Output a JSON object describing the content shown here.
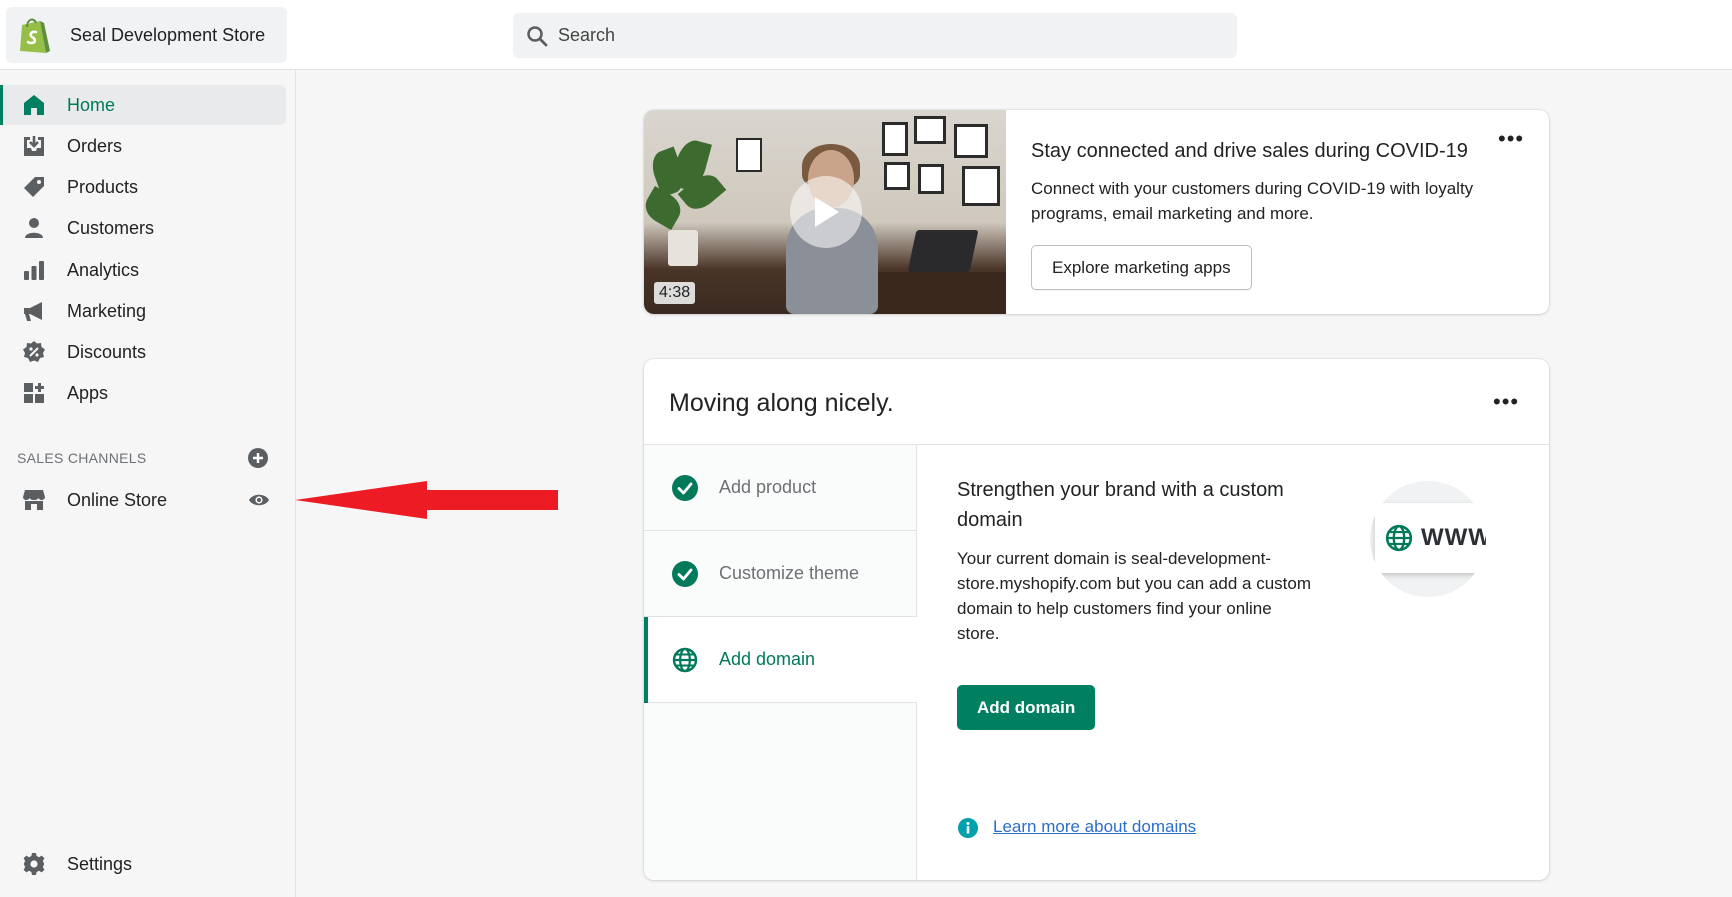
{
  "header": {
    "store_name": "Seal Development Store",
    "search_placeholder": "Search"
  },
  "sidebar": {
    "items": [
      {
        "label": "Home",
        "icon": "home-icon",
        "active": true
      },
      {
        "label": "Orders",
        "icon": "orders-icon"
      },
      {
        "label": "Products",
        "icon": "tag-icon"
      },
      {
        "label": "Customers",
        "icon": "person-icon"
      },
      {
        "label": "Analytics",
        "icon": "bar-chart-icon"
      },
      {
        "label": "Marketing",
        "icon": "megaphone-icon"
      },
      {
        "label": "Discounts",
        "icon": "discount-icon"
      },
      {
        "label": "Apps",
        "icon": "apps-icon"
      }
    ],
    "sales_channels_title": "SALES CHANNELS",
    "online_store_label": "Online Store",
    "settings_label": "Settings"
  },
  "promo_card": {
    "duration": "4:38",
    "title": "Stay connected and drive sales during COVID-19",
    "description": "Connect with your customers during COVID-19 with loyalty programs, email marketing and more.",
    "button_label": "Explore marketing apps",
    "more_label": "•••"
  },
  "setup_card": {
    "title": "Moving along nicely.",
    "more_label": "•••",
    "steps": [
      {
        "label": "Add product",
        "status": "complete"
      },
      {
        "label": "Customize theme",
        "status": "complete"
      },
      {
        "label": "Add domain",
        "status": "active"
      }
    ],
    "detail_title": "Strengthen your brand with a custom domain",
    "detail_description": "Your current domain is seal-development-store.myshopify.com but you can add a custom domain to help customers find your online store.",
    "primary_button_label": "Add domain",
    "illustration_text": "WWW",
    "learn_more_label": "Learn more about domains"
  },
  "colors": {
    "brand": "#008060",
    "link": "#2c6ecb",
    "annotation_arrow": "#ed1c24"
  }
}
